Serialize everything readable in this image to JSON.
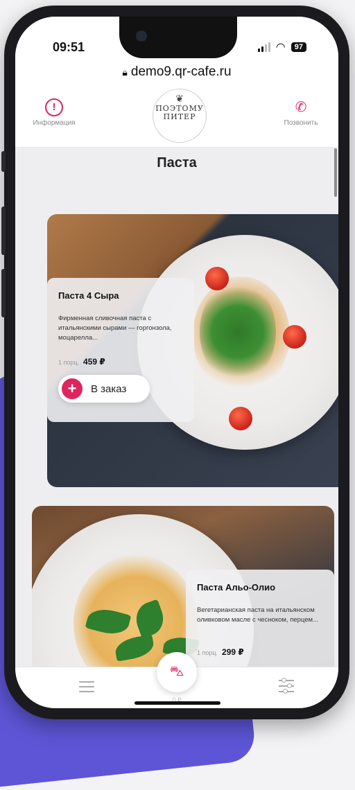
{
  "status_bar": {
    "time": "09:51",
    "battery": "97"
  },
  "browser": {
    "url": "demo9.qr-cafe.ru"
  },
  "header": {
    "info_label": "Информация",
    "call_label": "Позвонить",
    "logo_line1": "ПОЭТОМУ",
    "logo_line2": "ПИТЕР"
  },
  "section": {
    "title": "Паста"
  },
  "dishes": [
    {
      "name": "Паста 4 Сыра",
      "description": "Фирменная сливочная паста с итальянскими сырами — горгонзола, моцарелла...",
      "portion": "1 порц.",
      "price": "459 ₽",
      "order_label": "В заказ"
    },
    {
      "name": "Паста Альо-Олио",
      "description": "Вегетарианская паста на итальянском оливковом масле с чесноком, перцем...",
      "portion": "1 порц.",
      "price": "299 ₽"
    }
  ],
  "bottom_bar": {
    "cart_total": "0 ₽"
  },
  "colors": {
    "accent": "#e0245e",
    "background_shape": "#5d55d6"
  },
  "icons": [
    "info-icon",
    "phone-icon",
    "lock-icon",
    "wifi-icon",
    "signal-icon",
    "menu-icon",
    "cart-icon",
    "filter-icon",
    "plus-icon"
  ]
}
